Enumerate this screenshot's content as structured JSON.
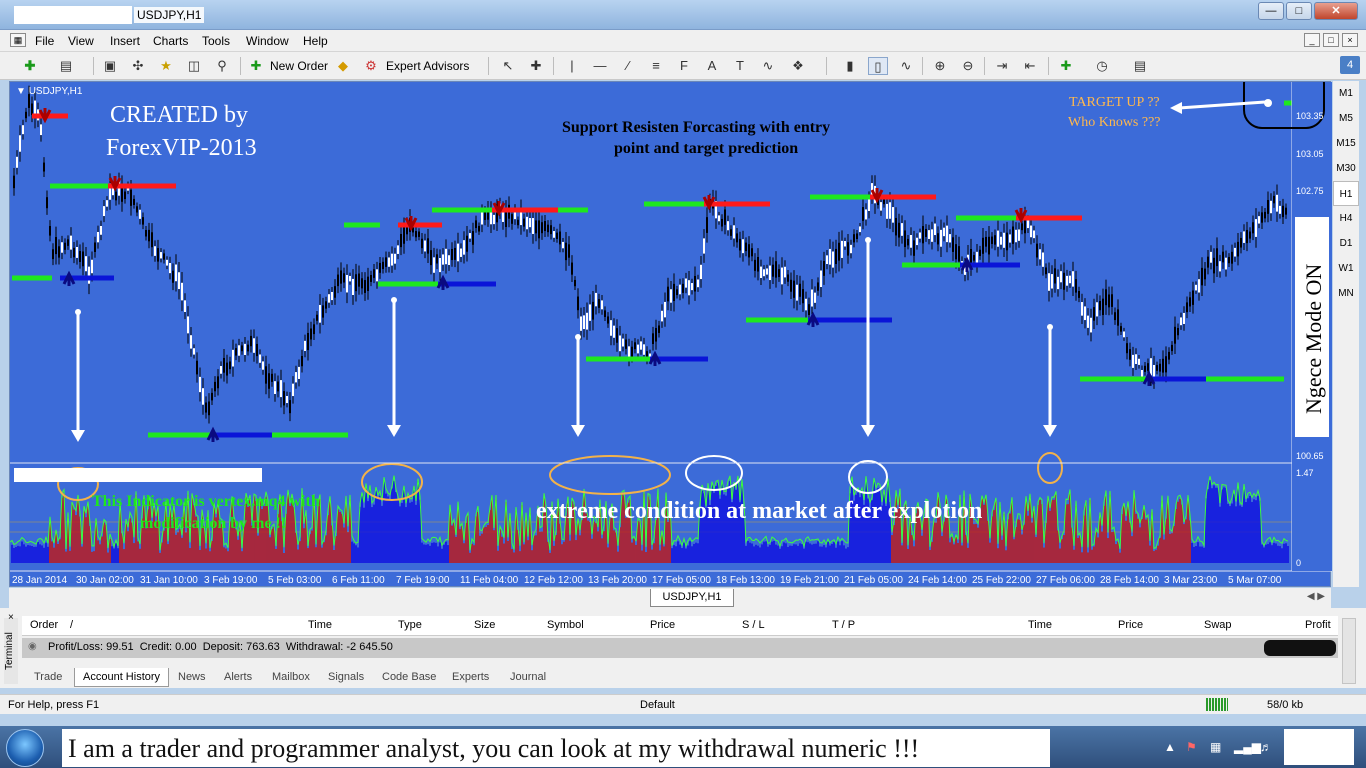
{
  "window": {
    "title": "USDJPY,H1"
  },
  "menu": [
    "File",
    "View",
    "Insert",
    "Charts",
    "Tools",
    "Window",
    "Help"
  ],
  "toolbar": {
    "new_order": "New Order",
    "expert_advisors": "Expert Advisors"
  },
  "timeframes": [
    "M1",
    "M5",
    "M15",
    "M30",
    "H1",
    "H4",
    "D1",
    "W1",
    "MN"
  ],
  "timeframe_selected": "H1",
  "toolbar_badge": "4",
  "chart": {
    "symbol_label": "USDJPY,H1",
    "created_by_1": "CREATED by",
    "created_by_2": "ForexVIP-2013",
    "subtitle_1": "Support Resisten Forcasting with entry",
    "subtitle_2": "point and target prediction",
    "target_1": "TARGET UP ??",
    "target_2": "Who Knows ???",
    "ngece": "Ngece Mode ON",
    "indicator_note_1": "This Indicator is vertex.mq4 with",
    "indicator_note_2": "modification by me !!",
    "extreme_note": "extreme condition at market after explotion",
    "background_color": "#3c6bd8",
    "up_color": "#1ee81e",
    "down_color": "#ff1a1a",
    "entry_up_color": "#0a14d8"
  },
  "chart_data": {
    "type": "candlestick",
    "price_axis_labels": [
      "103.35",
      "103.05",
      "102.75",
      "100.65"
    ],
    "indicator_axis_labels": [
      "1.47",
      "0"
    ],
    "time_axis_labels": [
      "28 Jan 2014",
      "30 Jan 02:00",
      "31 Jan 10:00",
      "3 Feb 19:00",
      "5 Feb 03:00",
      "6 Feb 11:00",
      "7 Feb 19:00",
      "11 Feb 04:00",
      "12 Feb 12:00",
      "13 Feb 20:00",
      "17 Feb 05:00",
      "18 Feb 13:00",
      "19 Feb 21:00",
      "21 Feb 05:00",
      "24 Feb 14:00",
      "25 Feb 22:00",
      "27 Feb 06:00",
      "28 Feb 14:00",
      "3 Mar 23:00",
      "5 Mar 07:00"
    ]
  },
  "chart_tab": "USDJPY,H1",
  "terminal": {
    "label": "Terminal",
    "headers": [
      "Order",
      "/",
      "Time",
      "Type",
      "Size",
      "Symbol",
      "Price",
      "S / L",
      "T / P",
      "Time",
      "Price",
      "Swap",
      "Profit"
    ],
    "summary": "Profit/Loss: 99.51  Credit: 0.00  Deposit: 763.63  Withdrawal: -2 645.50",
    "tabs": [
      "Trade",
      "Account History",
      "News",
      "Alerts",
      "Mailbox",
      "Signals",
      "Code Base",
      "Experts",
      "Journal"
    ],
    "selected_tab": "Account History"
  },
  "status": {
    "help": "For Help, press F1",
    "profile": "Default",
    "traffic": "58/0 kb"
  },
  "taskbar": {
    "message": "I am a trader and programmer analyst, you can look at my withdrawal numeric !!!"
  }
}
